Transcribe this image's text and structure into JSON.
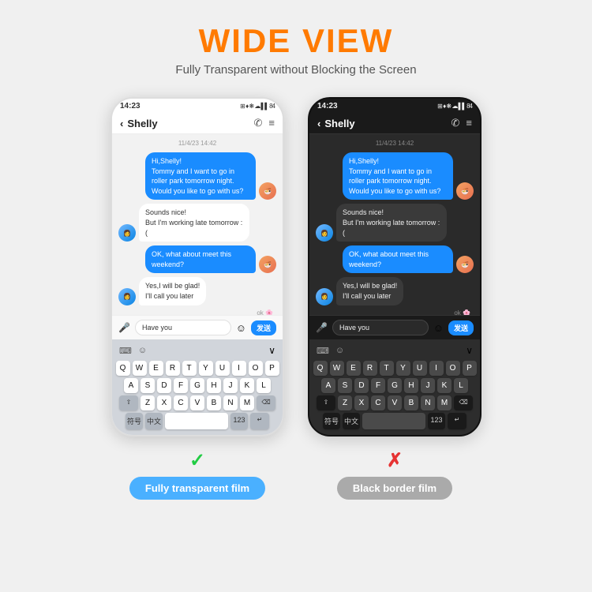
{
  "header": {
    "title": "WIDE VIEW",
    "subtitle": "Fully Transparent without Blocking the Screen"
  },
  "leftPhone": {
    "type": "white",
    "statusBar": {
      "time": "14:23",
      "icons": "⊞ ♦ ❋ ☁ .ull 84"
    },
    "chatHeader": {
      "name": "Shelly",
      "backIcon": "‹",
      "phoneIcon": "✆",
      "menuIcon": "≡"
    },
    "dateLabel": "11/4/23 14:42",
    "messages": [
      {
        "side": "right",
        "text": "Hi,Shelly!\nTommy and I want to go in roller park tomorrow night. Would you like to go with us?",
        "type": "blue"
      },
      {
        "side": "left",
        "text": "Sounds nice!\nBut I'm working late tomorrow :(",
        "type": "white"
      },
      {
        "side": "right",
        "text": "OK, what about meet this weekend?",
        "type": "blue"
      },
      {
        "side": "left",
        "text": "Yes,I will be glad!\nI'll call you later",
        "type": "white"
      }
    ],
    "inputArea": {
      "micIcon": "🎤",
      "placeholder": "Have you",
      "emojiIcon": "☺",
      "sendLabel": "发送"
    },
    "keyboard": {
      "rows": [
        [
          "Q",
          "W",
          "E",
          "R",
          "T",
          "Y",
          "U",
          "I",
          "O",
          "P"
        ],
        [
          "A",
          "S",
          "D",
          "F",
          "G",
          "H",
          "J",
          "K",
          "L"
        ],
        [
          "Z",
          "X",
          "C",
          "V",
          "B",
          "N",
          "M"
        ]
      ],
      "bottomRow": [
        "符号",
        "中文",
        " ",
        "123",
        "↵"
      ]
    },
    "badgeLabel": "Fully transparent film",
    "badgeType": "blue",
    "checkmark": "✓"
  },
  "rightPhone": {
    "type": "dark",
    "statusBar": {
      "time": "14:23",
      "icons": "⊞ ♦ ❋ ☁ .ull 84"
    },
    "chatHeader": {
      "name": "Shelly",
      "backIcon": "‹",
      "phoneIcon": "✆",
      "menuIcon": "≡"
    },
    "dateLabel": "11/4/23 14:42",
    "messages": [
      {
        "side": "right",
        "text": "Hi,Shelly!\nTommy and I want to go in roller park tomorrow night. Would you like to go with us?",
        "type": "blue"
      },
      {
        "side": "left",
        "text": "Sounds nice!\nBut I'm working late tomorrow :(",
        "type": "white"
      },
      {
        "side": "right",
        "text": "OK, what about meet this weekend?",
        "type": "blue"
      },
      {
        "side": "left",
        "text": "Yes,I will be glad!\nI'll call you later",
        "type": "white"
      }
    ],
    "inputArea": {
      "micIcon": "🎤",
      "placeholder": "Have you",
      "emojiIcon": "☺",
      "sendLabel": "发送"
    },
    "keyboard": {
      "rows": [
        [
          "Q",
          "W",
          "E",
          "R",
          "T",
          "Y",
          "U",
          "I",
          "O",
          "P"
        ],
        [
          "A",
          "S",
          "D",
          "F",
          "G",
          "H",
          "J",
          "K",
          "L"
        ],
        [
          "Z",
          "X",
          "C",
          "V",
          "B",
          "N",
          "M"
        ]
      ],
      "bottomRow": [
        "符号",
        "中文",
        " ",
        "123",
        "↵"
      ]
    },
    "badgeLabel": "Black border film",
    "badgeType": "gray",
    "crossmark": "✗"
  }
}
